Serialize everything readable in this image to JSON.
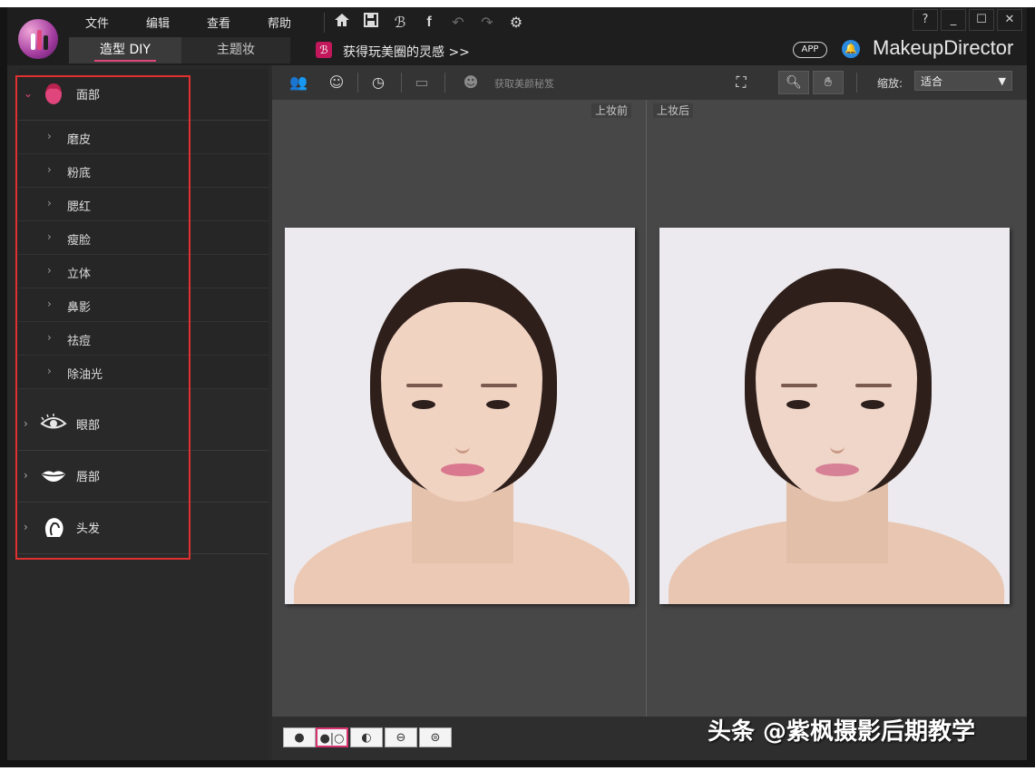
{
  "menu": [
    "文件",
    "编辑",
    "查看",
    "帮助"
  ],
  "tabs": [
    {
      "label": "造型 DIY",
      "active": true
    },
    {
      "label": "主题妆",
      "active": false
    }
  ],
  "toolbar_icons": [
    "home-icon",
    "save-icon",
    "brand-b-icon",
    "facebook-icon",
    "undo-icon",
    "redo-icon",
    "settings-icon"
  ],
  "promo": {
    "badge": "ℬ",
    "text": "获得玩美圈的灵感 >>"
  },
  "window_controls": {
    "help": "?",
    "minimize": "_",
    "maximize": "☐",
    "close": "✕"
  },
  "app_badge": "APP",
  "brand": "MakeupDirector",
  "sidebar": {
    "face": {
      "label": "面部",
      "items": [
        "磨皮",
        "粉底",
        "腮红",
        "瘦脸",
        "立体",
        "鼻影",
        "祛痘",
        "除油光"
      ]
    },
    "eyes": {
      "label": "眼部"
    },
    "lips": {
      "label": "唇部"
    },
    "hair": {
      "label": "头发"
    }
  },
  "edit_toolbar": {
    "tip_text": "获取美颜秘笈",
    "zoom_label": "缩放:",
    "zoom_value": "适合"
  },
  "canvas": {
    "before_label": "上妆前",
    "after_label": "上妆后"
  },
  "view_modes": [
    "single-view",
    "side-by-side-view",
    "split-vertical-view",
    "split-horizontal-view",
    "split-diagonal-view"
  ],
  "watermark": "头条 @紫枫摄影后期教学",
  "colors": {
    "accent": "#e0457b",
    "selection_box": "#e03030",
    "bell": "#2a8ae0"
  }
}
